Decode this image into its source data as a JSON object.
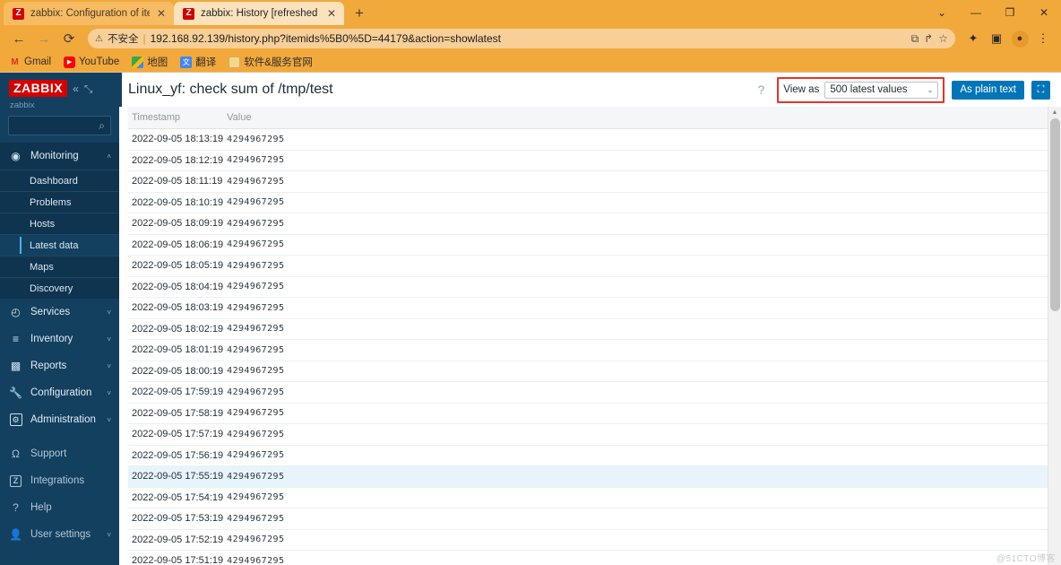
{
  "browser": {
    "tabs": [
      {
        "title": "zabbix: Configuration of items",
        "favicon": "zabbix-favicon",
        "active": false,
        "close_label": "✕"
      },
      {
        "title": "zabbix: History [refreshed ever",
        "favicon": "zabbix-favicon",
        "active": true,
        "close_label": "✕"
      }
    ],
    "new_tab_label": "+",
    "window_controls": {
      "menu": "⌄",
      "minimize": "—",
      "maximize": "❐",
      "close": "✕"
    },
    "nav": {
      "back": "←",
      "forward": "→",
      "reload": "⟳"
    },
    "omnibox": {
      "warning_icon": "⚠",
      "security_label": "不安全",
      "separator": "|",
      "url": "192.168.92.139/history.php?itemids%5B0%5D=44179&action=showlatest",
      "translate_icon": "⧉",
      "share_icon": "↱",
      "bookmark_icon": "☆"
    },
    "toolbar_icons": {
      "extensions": "✦",
      "sidepanel": "▣",
      "profile": "●",
      "menu": "⋮"
    },
    "bookmarks": [
      {
        "label": "Gmail",
        "icon": "gmail-icon",
        "glyph": "M"
      },
      {
        "label": "YouTube",
        "icon": "youtube-icon",
        "glyph": "▶"
      },
      {
        "label": "地图",
        "icon": "maps-icon",
        "glyph": ""
      },
      {
        "label": "翻译",
        "icon": "translate-icon",
        "glyph": "文"
      },
      {
        "label": "软件&服务官网",
        "icon": "folder-icon",
        "glyph": ""
      }
    ]
  },
  "sidebar": {
    "logo": "ZABBIX",
    "collapse_icon": "«",
    "compact_icon": "⤡",
    "server_name": "zabbix",
    "search_placeholder": "",
    "search_icon": "⌕",
    "nav": [
      {
        "label": "Monitoring",
        "icon": "eye-icon",
        "glyph": "◉",
        "expanded": true,
        "caret": "˄",
        "children": [
          {
            "label": "Dashboard",
            "active": false
          },
          {
            "label": "Problems",
            "active": false
          },
          {
            "label": "Hosts",
            "active": false
          },
          {
            "label": "Latest data",
            "active": true
          },
          {
            "label": "Maps",
            "active": false
          },
          {
            "label": "Discovery",
            "active": false
          }
        ]
      },
      {
        "label": "Services",
        "icon": "clock-icon",
        "glyph": "◴",
        "caret": "˅",
        "children": []
      },
      {
        "label": "Inventory",
        "icon": "list-icon",
        "glyph": "≡",
        "caret": "˅",
        "children": []
      },
      {
        "label": "Reports",
        "icon": "bar-chart-icon",
        "glyph": "█",
        "caret": "˅",
        "children": []
      },
      {
        "label": "Configuration",
        "icon": "wrench-icon",
        "glyph": "ᴰ",
        "caret": "˅",
        "children": []
      },
      {
        "label": "Administration",
        "icon": "gear-square-icon",
        "glyph": "⚙",
        "caret": "˅",
        "children": []
      }
    ],
    "lower_nav": [
      {
        "label": "Support",
        "icon": "headset-icon",
        "glyph": "Ω",
        "caret": ""
      },
      {
        "label": "Integrations",
        "icon": "zabbix-z-icon",
        "glyph": "Z",
        "caret": ""
      },
      {
        "label": "Help",
        "icon": "question-icon",
        "glyph": "?",
        "caret": ""
      },
      {
        "label": "User settings",
        "icon": "person-icon",
        "glyph": "●",
        "caret": "˅"
      }
    ]
  },
  "page": {
    "title": "Linux_yf: check sum of /tmp/test",
    "help_icon": "?",
    "view_as_label": "View as",
    "view_as_value": "500 latest values",
    "view_as_caret": "⌄",
    "as_plain_text_label": "As plain text",
    "kiosk_icon": "⛶",
    "highlight_color": "#e8332a",
    "accent_color": "#0275b8"
  },
  "table": {
    "columns": [
      "Timestamp",
      "Value"
    ],
    "rows": [
      {
        "timestamp": "2022-09-05 18:13:19",
        "value": "4294967295",
        "hover": false
      },
      {
        "timestamp": "2022-09-05 18:12:19",
        "value": "4294967295",
        "hover": false
      },
      {
        "timestamp": "2022-09-05 18:11:19",
        "value": "4294967295",
        "hover": false
      },
      {
        "timestamp": "2022-09-05 18:10:19",
        "value": "4294967295",
        "hover": false
      },
      {
        "timestamp": "2022-09-05 18:09:19",
        "value": "4294967295",
        "hover": false
      },
      {
        "timestamp": "2022-09-05 18:06:19",
        "value": "4294967295",
        "hover": false
      },
      {
        "timestamp": "2022-09-05 18:05:19",
        "value": "4294967295",
        "hover": false
      },
      {
        "timestamp": "2022-09-05 18:04:19",
        "value": "4294967295",
        "hover": false
      },
      {
        "timestamp": "2022-09-05 18:03:19",
        "value": "4294967295",
        "hover": false
      },
      {
        "timestamp": "2022-09-05 18:02:19",
        "value": "4294967295",
        "hover": false
      },
      {
        "timestamp": "2022-09-05 18:01:19",
        "value": "4294967295",
        "hover": false
      },
      {
        "timestamp": "2022-09-05 18:00:19",
        "value": "4294967295",
        "hover": false
      },
      {
        "timestamp": "2022-09-05 17:59:19",
        "value": "4294967295",
        "hover": false
      },
      {
        "timestamp": "2022-09-05 17:58:19",
        "value": "4294967295",
        "hover": false
      },
      {
        "timestamp": "2022-09-05 17:57:19",
        "value": "4294967295",
        "hover": false
      },
      {
        "timestamp": "2022-09-05 17:56:19",
        "value": "4294967295",
        "hover": false
      },
      {
        "timestamp": "2022-09-05 17:55:19",
        "value": "4294967295",
        "hover": true
      },
      {
        "timestamp": "2022-09-05 17:54:19",
        "value": "4294967295",
        "hover": false
      },
      {
        "timestamp": "2022-09-05 17:53:19",
        "value": "4294967295",
        "hover": false
      },
      {
        "timestamp": "2022-09-05 17:52:19",
        "value": "4294967295",
        "hover": false
      },
      {
        "timestamp": "2022-09-05 17:51:19",
        "value": "4294967295",
        "hover": false
      }
    ]
  },
  "scrollbar": {
    "up_arrow": "▲",
    "down_arrow": "▼"
  },
  "watermark": "@51CTO博客"
}
